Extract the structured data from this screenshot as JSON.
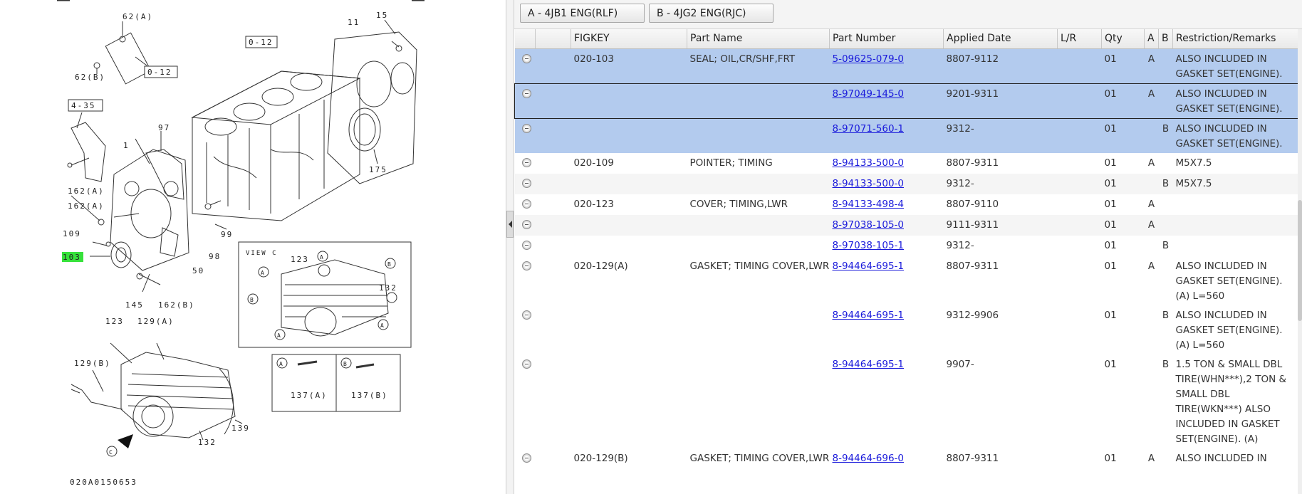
{
  "diagram": {
    "code": "020A0150653",
    "labels": {
      "l62a": "62(A)",
      "l62b": "62(B)",
      "l012a": "0-12",
      "l012b": "0-12",
      "l11": "11",
      "l15": "15",
      "l435": "4-35",
      "l97": "97",
      "l1": "1",
      "l162a1": "162(A)",
      "l162a2": "162(A)",
      "l109": "109",
      "l103": "103",
      "l145": "145",
      "l162b": "162(B)",
      "l50": "50",
      "l98": "98",
      "l99": "99",
      "l175": "175",
      "l123": "123",
      "l129a": "129(A)",
      "l129b": "129(B)",
      "l132": "132",
      "l139": "139",
      "lc": "C",
      "view": "VIEW C",
      "v123": "123",
      "v132": "132",
      "va1": "A",
      "va2": "A",
      "va3": "A",
      "va4": "A",
      "vb1": "B",
      "vb2": "B",
      "ka": "A",
      "kb": "B",
      "k137a": "137(A)",
      "k137b": "137(B)"
    },
    "highlight_color": "#37e13b"
  },
  "tabs": {
    "engine_a": "A - 4JB1 ENG(RLF)",
    "engine_b": "B - 4JG2 ENG(RJC)"
  },
  "table": {
    "headers": {
      "figkey": "FIGKEY",
      "name": "Part Name",
      "number": "Part Number",
      "date": "Applied Date",
      "lr": "L/R",
      "qty": "Qty",
      "a": "A",
      "b": "B",
      "remarks": "Restriction/Remarks"
    },
    "rows": [
      {
        "figkey": "020-103",
        "name": "SEAL; OIL,CR/SHF,FRT",
        "number": "5-09625-079-0",
        "date": "8807-9112",
        "lr": "",
        "qty": "01",
        "a": "A",
        "b": "",
        "remarks": "ALSO INCLUDED IN GASKET SET(ENGINE)."
      },
      {
        "figkey": "",
        "name": "",
        "number": "8-97049-145-0",
        "date": "9201-9311",
        "lr": "",
        "qty": "01",
        "a": "A",
        "b": "",
        "remarks": "ALSO INCLUDED IN GASKET SET(ENGINE)."
      },
      {
        "figkey": "",
        "name": "",
        "number": "8-97071-560-1",
        "date": "9312-",
        "lr": "",
        "qty": "01",
        "a": "",
        "b": "B",
        "remarks": "ALSO INCLUDED IN GASKET SET(ENGINE)."
      },
      {
        "figkey": "020-109",
        "name": "POINTER; TIMING",
        "number": "8-94133-500-0",
        "date": "8807-9311",
        "lr": "",
        "qty": "01",
        "a": "A",
        "b": "",
        "remarks": "M5X7.5"
      },
      {
        "figkey": "",
        "name": "",
        "number": "8-94133-500-0",
        "date": "9312-",
        "lr": "",
        "qty": "01",
        "a": "",
        "b": "B",
        "remarks": "M5X7.5"
      },
      {
        "figkey": "020-123",
        "name": "COVER; TIMING,LWR",
        "number": "8-94133-498-4",
        "date": "8807-9110",
        "lr": "",
        "qty": "01",
        "a": "A",
        "b": "",
        "remarks": ""
      },
      {
        "figkey": "",
        "name": "",
        "number": "8-97038-105-0",
        "date": "9111-9311",
        "lr": "",
        "qty": "01",
        "a": "A",
        "b": "",
        "remarks": ""
      },
      {
        "figkey": "",
        "name": "",
        "number": "8-97038-105-1",
        "date": "9312-",
        "lr": "",
        "qty": "01",
        "a": "",
        "b": "B",
        "remarks": ""
      },
      {
        "figkey": "020-129(A)",
        "name": "GASKET; TIMING COVER,LWR",
        "number": "8-94464-695-1",
        "date": "8807-9311",
        "lr": "",
        "qty": "01",
        "a": "A",
        "b": "",
        "remarks": "ALSO INCLUDED IN GASKET SET(ENGINE). (A) L=560"
      },
      {
        "figkey": "",
        "name": "",
        "number": "8-94464-695-1",
        "date": "9312-9906",
        "lr": "",
        "qty": "01",
        "a": "",
        "b": "B",
        "remarks": "ALSO INCLUDED IN GASKET SET(ENGINE). (A) L=560"
      },
      {
        "figkey": "",
        "name": "",
        "number": "8-94464-695-1",
        "date": "9907-",
        "lr": "",
        "qty": "01",
        "a": "",
        "b": "B",
        "remarks": "1.5 TON & SMALL DBL TIRE(WHN***),2 TON & SMALL DBL TIRE(WKN***) ALSO INCLUDED IN GASKET SET(ENGINE). (A)"
      },
      {
        "figkey": "020-129(B)",
        "name": "GASKET; TIMING COVER,LWR",
        "number": "8-94464-696-0",
        "date": "8807-9311",
        "lr": "",
        "qty": "01",
        "a": "A",
        "b": "",
        "remarks": "ALSO INCLUDED IN"
      }
    ]
  }
}
